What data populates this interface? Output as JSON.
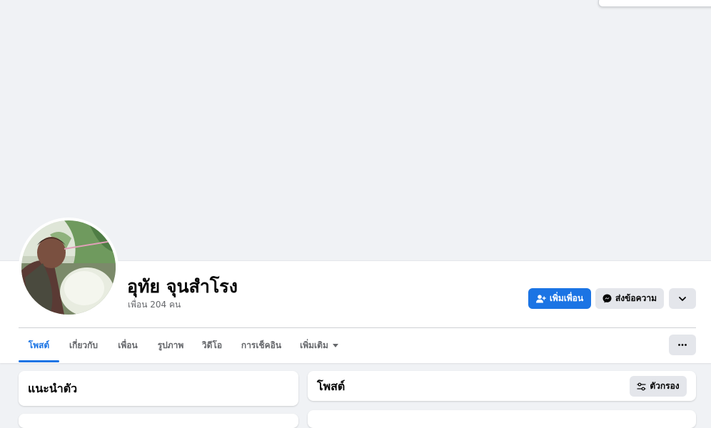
{
  "profile": {
    "name": "อุทัย จุนสำโรง",
    "friends_count": "เพื่อน 204 คน"
  },
  "actions": {
    "add_friend": "เพิ่มเพื่อน",
    "message": "ส่งข้อความ",
    "add_friend_icon": "add-person-icon",
    "message_icon": "messenger-icon",
    "more_icon": "chevron-down-icon"
  },
  "tabs": [
    {
      "label": "โพสต์",
      "active": true
    },
    {
      "label": "เกี่ยวกับ",
      "active": false
    },
    {
      "label": "เพื่อน",
      "active": false
    },
    {
      "label": "รูปภาพ",
      "active": false
    },
    {
      "label": "วิดีโอ",
      "active": false
    },
    {
      "label": "การเช็คอิน",
      "active": false
    },
    {
      "label": "เพิ่มเติม",
      "active": false
    }
  ],
  "intro": {
    "title": "แนะนำตัว"
  },
  "posts": {
    "title": "โพสต์",
    "filter_label": "ตัวกรอง",
    "filter_icon": "sliders-icon"
  },
  "colors": {
    "accent": "#1b74e4",
    "background": "#f0f2f5",
    "secondary_button": "#e4e6eb",
    "muted_text": "#65676b"
  }
}
